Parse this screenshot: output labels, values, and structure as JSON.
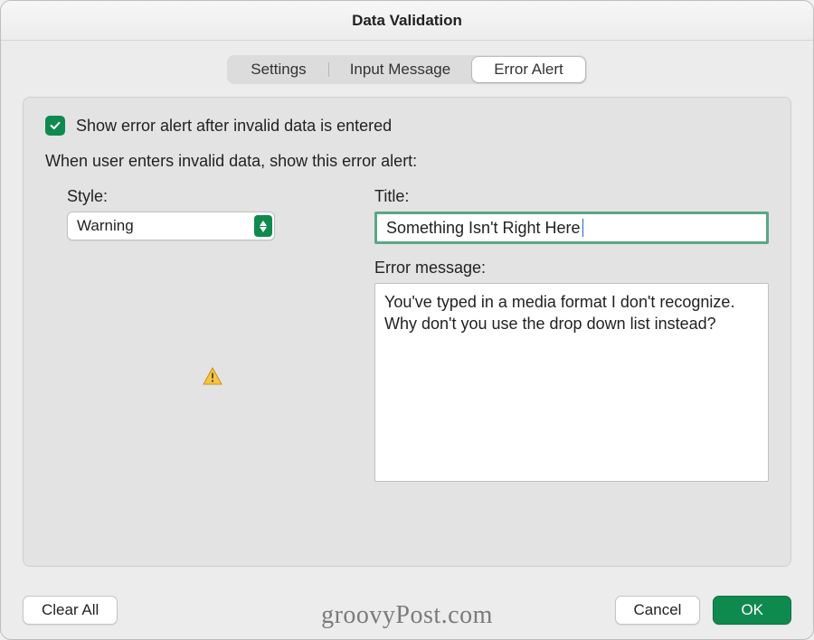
{
  "window": {
    "title": "Data Validation"
  },
  "tabs": {
    "settings": "Settings",
    "input_message": "Input Message",
    "error_alert": "Error Alert",
    "active": "error_alert"
  },
  "checkbox": {
    "checked": true,
    "label": "Show error alert after invalid data is entered"
  },
  "instruction": "When user enters invalid data, show this error alert:",
  "style": {
    "label": "Style:",
    "value": "Warning"
  },
  "title_field": {
    "label": "Title:",
    "value": "Something Isn't Right Here"
  },
  "error_message": {
    "label": "Error message:",
    "value": "You've typed in a media format I don't recognize. Why don't you use the drop down list instead?"
  },
  "buttons": {
    "clear_all": "Clear All",
    "cancel": "Cancel",
    "ok": "OK"
  },
  "watermark": "groovyPost.com",
  "colors": {
    "accent": "#0f8a4f"
  }
}
